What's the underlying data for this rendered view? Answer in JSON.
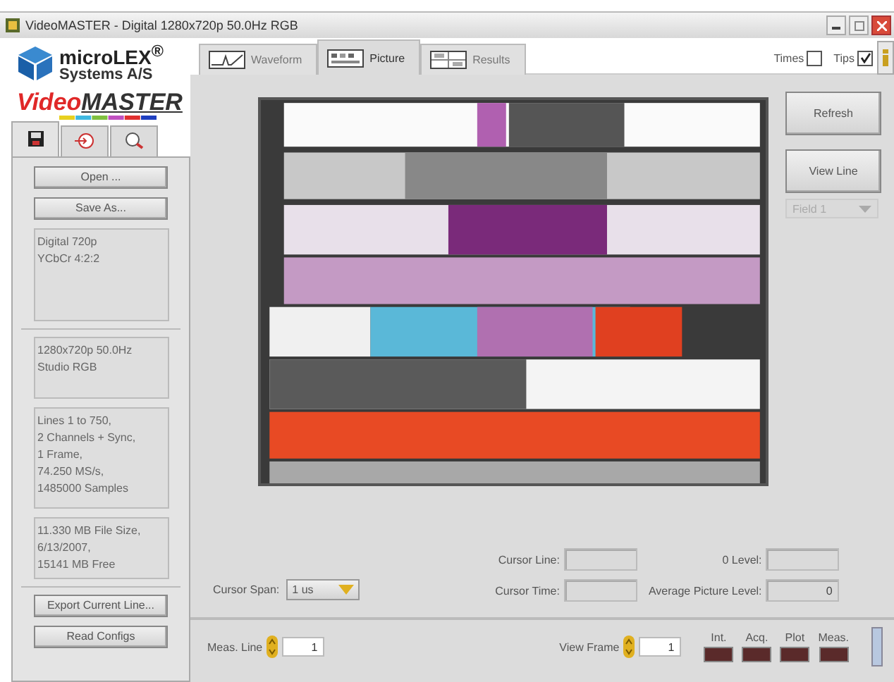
{
  "window": {
    "title": "VideoMASTER - Digital 1280x720p 50.0Hz RGB"
  },
  "logo": {
    "company": "microLEX$^{®}$",
    "company_line_2": "Systems A/S",
    "product_part_1": "Video",
    "product_part_2": "MASTER"
  },
  "side_tabs": [
    {
      "selected": true
    },
    {
      "selected": false
    },
    {
      "selected": false
    }
  ],
  "side_buttons_top": [
    "Open ...",
    "Save As..."
  ],
  "info_boxes": [
    {
      "lines": [
        "Digital 720p",
        "YCbCr 4:2:2"
      ]
    },
    {
      "lines": [
        "1280x720p 50.0Hz",
        "Studio RGB"
      ]
    },
    {
      "lines": [
        "Lines 1 to 750,",
        "2 Channels + Sync,",
        "1 Frame,",
        "74.250 MS/s,",
        "1485000 Samples"
      ]
    },
    {
      "lines": [
        "11.330 MB File Size,",
        "6/13/2007,",
        "15141 MB Free"
      ]
    }
  ],
  "side_buttons_bottom": [
    "Export Current Line...",
    "Read Configs"
  ],
  "tabs": [
    {
      "label": "Waveform",
      "selected": false
    },
    {
      "label": "Picture",
      "selected": true
    },
    {
      "label": "Results",
      "selected": false
    }
  ],
  "options": [
    {
      "label": "Times",
      "checked": false
    },
    {
      "label": "Tips",
      "checked": true
    }
  ],
  "right_buttons": [
    "Refresh",
    "View Line"
  ],
  "field_select": {
    "value": "Field 1",
    "disabled": true
  },
  "cursor_span": {
    "label": "Cursor Span:",
    "value": "1 us"
  },
  "readouts": [
    {
      "label": "Cursor Line:"
    },
    {
      "label": "0 Level:"
    },
    {
      "label": "Cursor Time:"
    },
    {
      "label": "Average Picture Level:",
      "value": "0"
    }
  ],
  "meas_line": {
    "label": "Meas. Line",
    "value": "1"
  },
  "view_frame": {
    "label": "View Frame",
    "value": "1"
  },
  "indicators": [
    {
      "label": "Int.",
      "on": false
    },
    {
      "label": "Acq.",
      "on": false
    },
    {
      "label": "Plot",
      "on": false
    },
    {
      "label": "Meas.",
      "on": false
    }
  ]
}
